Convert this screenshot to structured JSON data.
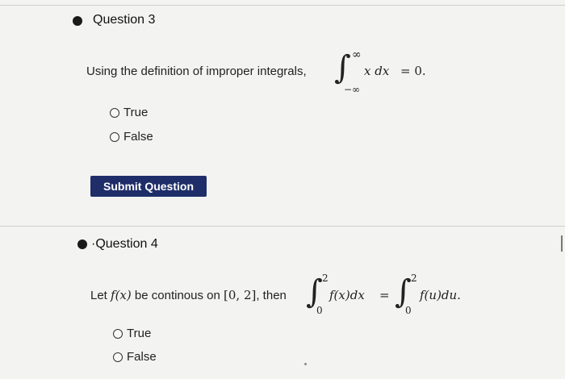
{
  "q3": {
    "title": "Question 3",
    "prompt_text": "Using the definition of improper integrals,",
    "upper": "∞",
    "lower": "−∞",
    "integrand": "x dx",
    "equals": "= 0.",
    "options": [
      "True",
      "False"
    ],
    "submit_label": "Submit Question"
  },
  "q4": {
    "title": "·Question 4",
    "prompt_pre": "Let",
    "fx": "f(x)",
    "prompt_mid": "be continous on",
    "interval": "[0, 2]",
    "prompt_then": ", then",
    "upper1": "2",
    "lower1": "0",
    "integrand1": "f(x)dx",
    "eq": "=",
    "upper2": "2",
    "lower2": "0",
    "integrand2": "f(u)du.",
    "options": [
      "True",
      "False"
    ]
  }
}
